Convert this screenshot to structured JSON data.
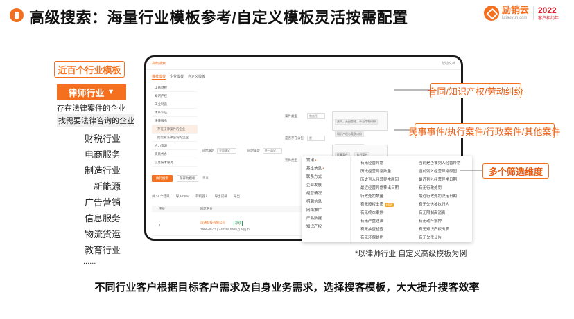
{
  "header": {
    "title": "高级搜索：海量行业模板参考/自定义模板灵活按需配置",
    "logo_brand": "励销云",
    "logo_domain": "lixiaoyun.com",
    "logo_year": "2022",
    "logo_year_sub": "客户相约年"
  },
  "left_panel": {
    "industry_tag": "近百个行业模板",
    "selected_industry": "律师行业",
    "selected_arrow": "▼",
    "descriptions": [
      "存在法律案件的企业",
      "找需要法律咨询的企业"
    ],
    "industries": [
      "财税行业",
      "电商服务",
      "制造行业",
      "新能源",
      "广告营销",
      "信息服务",
      "物流货运",
      "教育行业"
    ],
    "more": "......"
  },
  "screen": {
    "topbar_title": "高级搜索",
    "topbar_right": "帮助文档",
    "tabs": [
      "推荐模板",
      "企业模板",
      "自定义模板"
    ],
    "side_items": [
      {
        "label": "工商财税",
        "hl": false,
        "sub": false
      },
      {
        "label": "知识产权",
        "hl": false,
        "sub": false
      },
      {
        "label": "工业制造",
        "hl": false,
        "sub": false
      },
      {
        "label": "体系认证",
        "hl": false,
        "sub": false
      },
      {
        "label": "法律服务",
        "hl": false,
        "sub": false
      },
      {
        "label": "存在法律案件的企业",
        "hl": true,
        "sub": true
      },
      {
        "label": "找需要法律咨询的企业",
        "hl": false,
        "sub": true
      },
      {
        "label": "人力资源",
        "hl": false,
        "sub": false
      },
      {
        "label": "资质代办",
        "hl": false,
        "sub": false
      },
      {
        "label": "信息技术服务",
        "hl": false,
        "sub": false
      }
    ],
    "cond_labels": [
      "案件类型",
      "是否存在公告",
      "案件类型",
      "同时满足",
      "同时满足"
    ],
    "select_values": [
      "包含任一",
      "是",
      "包含任一",
      "全部满足",
      "任一满足"
    ],
    "chips_1": [
      "合同、无因管理、不当得利纠纷",
      "知识产权与竞争纠纷",
      "劳动争议、人事争议"
    ],
    "chips_2": [
      "民事案件",
      "执行案件",
      "行政案件",
      "刑事案件",
      "国家赔偿案件",
      "管辖案件",
      "强制清算与破产案件",
      "其他案件"
    ],
    "action_btn": "执行搜索",
    "save_btn": "保存为模板",
    "reset_link": "重置",
    "filter_count": "共 14 个结果",
    "filter_items": [
      "导入CRM",
      "转机器人",
      "导出记录",
      "导出"
    ],
    "table_headers": [
      "序号",
      "园区名片"
    ],
    "row_company": "运通科技有限公司",
    "row_detail": "1996-08-22  |  440209.5585万人民币",
    "row_id": "1",
    "row_tag": "存续"
  },
  "popup": {
    "categories": [
      {
        "label": "常用",
        "dot": true
      },
      {
        "label": "基本信息",
        "dot": true
      },
      {
        "label": "联系方式",
        "dot": false
      },
      {
        "label": "企业发展",
        "dot": false
      },
      {
        "label": "经营情况",
        "dot": false
      },
      {
        "label": "招聘信息",
        "dot": false
      },
      {
        "label": "网络推广",
        "dot": false
      },
      {
        "label": "产品数据",
        "dot": false
      },
      {
        "label": "知识产权",
        "dot": false
      }
    ],
    "col1": [
      "有无经营异常",
      "历史经营异常数量",
      "历史列入经营异常原因",
      "最近经营异常移出日期",
      "行政处罚数量",
      "有无股权出质",
      "有无终本案件",
      "有无严重违法",
      "有无抽查检查",
      "有无环保处罚"
    ],
    "col1_new_index": 5,
    "col1_new_label": "NEW",
    "col2": [
      "当前是否被列入经营异常",
      "当前列入经营异常原因",
      "最近列入经营异常日期",
      "有无行政处罚",
      "最近行政处罚决定日期",
      "有无失信被执行人",
      "有无限制高消费",
      "有无动产抵押",
      "有无知识产权出质",
      "有无欠税公告"
    ]
  },
  "callouts": {
    "c1": "合同/知识产权/劳动纠纷",
    "c2": "民事事件/执行案件/行政案件/其他案件",
    "c3": "多个筛选维度"
  },
  "note": "*以律师行业 自定义高级模板为例",
  "footer": "不同行业客户根据目标客户需求及自身业务需求，选择搜客模板，大大提升搜客效率",
  "colors": {
    "accent": "#f4701f",
    "callout_text": "#e85d12"
  }
}
